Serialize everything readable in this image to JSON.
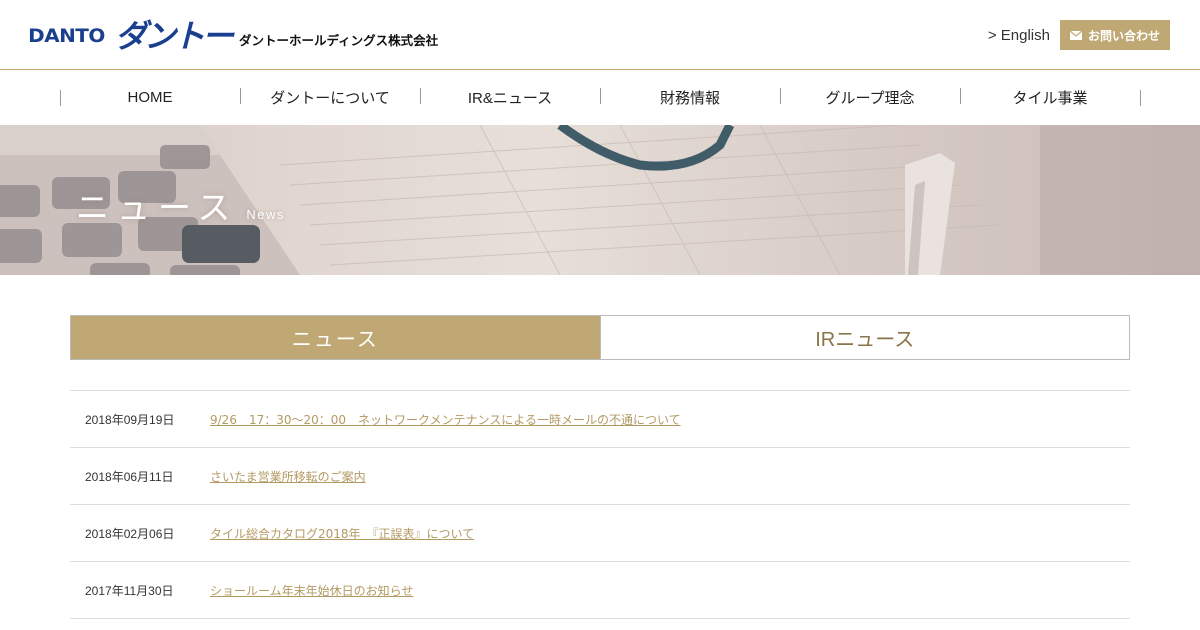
{
  "header": {
    "logo_en": "DANTO",
    "logo_jp": "ダントー",
    "company_name": "ダントーホールディングス株式会社",
    "lang_link": "> English",
    "contact_label": "お問い合わせ",
    "contact_icon": "mail-icon"
  },
  "nav": {
    "items": [
      {
        "label": "HOME"
      },
      {
        "label": "ダントーについて"
      },
      {
        "label": "IR&ニュース"
      },
      {
        "label": "財務情報"
      },
      {
        "label": "グループ理念"
      },
      {
        "label": "タイル事業"
      }
    ]
  },
  "hero": {
    "title": "ニュース",
    "subtitle": "News"
  },
  "tabs": [
    {
      "label": "ニュース",
      "active": true
    },
    {
      "label": "IRニュース",
      "active": false
    }
  ],
  "news": [
    {
      "date": "2018年09月19日",
      "title": "9/26　17：30～20：00　ネットワークメンテナンスによる一時メールの不通について"
    },
    {
      "date": "2018年06月11日",
      "title": "さいたま営業所移転のご案内"
    },
    {
      "date": "2018年02月06日",
      "title": "タイル総合カタログ2018年　『正誤表』について"
    },
    {
      "date": "2017年11月30日",
      "title": "ショールーム年末年始休日のお知らせ"
    }
  ],
  "colors": {
    "brand_blue": "#1b3f8f",
    "accent_gold": "#bfa873",
    "link_gold": "#b39a62"
  }
}
